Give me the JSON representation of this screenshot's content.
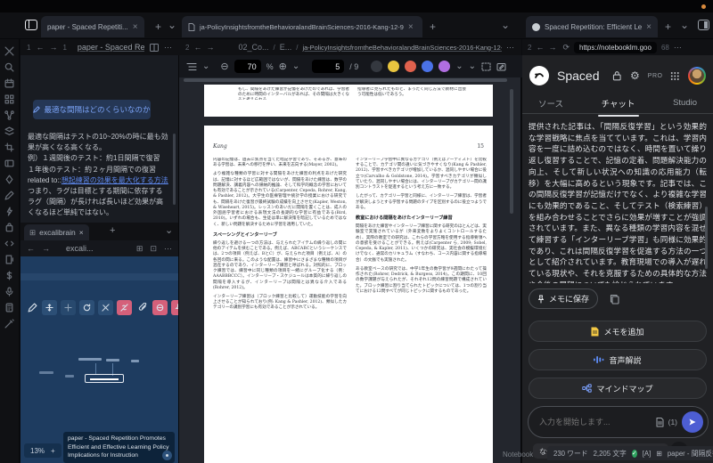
{
  "glyphs": {
    "close": "×",
    "plus": "+",
    "chevron_down": "⌄",
    "more": "⋯",
    "back": "←",
    "forward": "→",
    "reload": "⟳",
    "gear": "⚙",
    "zoom_out": "⊖",
    "zoom_in": "⊕",
    "percent": "%",
    "slash": "/ 9",
    "grid_box": "⊞",
    "box_dot": "⊡",
    "check": "✓",
    "chevron_right": "›"
  },
  "tabbar": {
    "pane1_tab": "paper - Spaced Repetiti...",
    "pane2_tab": "ja-PolicyInsightsfromtheBehavioralandBrainSciences-2016-Kang-12-9",
    "pane3_tab": "Spaced Repetition: Efficient Learn..."
  },
  "nav1": {
    "back_count": "1",
    "forward_count": "1",
    "title": "paper - Spaced Re..."
  },
  "nav2": {
    "back_count": "2",
    "crumb1": "02_Co...",
    "sep": "/",
    "crumb2": "E...",
    "crumb3": "ja-PolicyInsightsfromtheBehavioralandBrainSciences-2016-Kang-12-9"
  },
  "nav3": {
    "back_count": "2",
    "url": "https://notebooklm.goo",
    "count": "68"
  },
  "notes": {
    "callout": "最適な間隔はどのくらいなのか",
    "p1": "最適な間隔はテストの10~20%の時に最も効果が高くなる高くなる。",
    "p2": "例）１週間後のテスト：約1日間隔で復習",
    "p3": "１年後のテスト：約２ヶ月間隔での復習",
    "related_label": "related to::",
    "related_link": "想起練習の効果を最大化する方法",
    "p4": "つまり、ラグは目標とする期間に依存する",
    "p5": "ラグ（間隔）が長ければ長いほど効果が高くなるほど単純ではない。"
  },
  "excalibrain": {
    "tab": "excalibrain",
    "pane_title": "excali...",
    "zoom": "13%",
    "node_title": "paper - Spaced Repetition Promotes Efficient and Effective Learning Policy Implications for Instruction"
  },
  "pdf": {
    "zoom_value": "70",
    "page_value": "5",
    "page_total": "/ 9",
    "colors": {
      "yellow": "#e9c53f",
      "red": "#e0614d",
      "blue": "#4a72e8",
      "purple": "#b06ee0"
    },
    "page4_left": "もし、間隔をあけた練習が記憶をあげたのであれば、学習者のために時間のインターバルがあれば、その間隔は大きくなると考えられる。",
    "page4_right": "指導者に見られたものと、まったく同じ方法で教材に出会う可能性は低いであろう。",
    "page5": {
      "header_left": "Kang",
      "header_right": "15",
      "left_p1": "内容の記憶は、過去に焦点を当てた暗記学習であり、そあるか、意味のある学習は、未来への移行を伴い、未来を志向する(Mayer, 2002)。",
      "left_p2": "より複雑な種類の学習に対する間隔をあけた練習の利点をあげた研究は、記憶に対するほど広範囲ではないが、間隔をあけた練習は、数学の問題解決、講義内容への帰納的推論、そして科学的概念の学習においても有効であることが示されている(Carpenter, Cepeda, Rohrer, Kang, & Pashler, 2012)。大学生の医療管理や統計学の授業における研究でも、間隔をあけた復習が最終試験の成績を向上させた(Kapler, Weston, & Wiseheart, 2015)。レッスンのあいだに間隔を置くことは、成人の外国語学習者における表現文法の長期的な学習に有益である(Bird, 2010)。いずれの場合も、生徒は単に解決策を暗記しているためではなく、新しい問題を解決するために学習を適用していた。",
      "left_heading": "スペーシングとインターリーブ",
      "left_p3": "繰り返しを避ける一つの方法は、与えられたアイテムの繰り返しの間に他のアイテムを挟むことである。例えば、ABCABCというシーケンスでは、2つの項目（例えば、BとC）が、与えられた項目（例えば、A）の各回の間に来る。このような配置は、練習中にさまざまな種類の項目が混在するのであり、インターリーブ練習と呼ばれる。対照的に、ブロック練習では、練習中に同じ種類の項目を一緒にグループ化する（例：AAABBBCCC）。インターリーブ・スケジュールは本質的に繰り返しの間隔を導入するが、インターリーブは間隔とは異なる介入である(Rohrer, 2012)。",
      "left_p4": "インターリーブ練習は（ブロック練習と比較して）運動技能の学習を向上させることが知られており(例: Kang & Pashler, 2012)、類似したカテゴリーの識別学習にも有効であることが示されている。",
      "right_p1": "インターリーブ学習中に異なるカテゴリ（例えばアーティスト）を比較することで、カテゴリ間の違いに気づきやすくなり(Kang & Pashler, 2012)、学習すべきカテゴリが増加しているか、混同しやすい場合に役立つ(Carvalho & Goldstone, 2014)。学習すべきカテゴリが類似していたり、混同しやすい場合には、インターリーブがカテゴリー間の識別コントラストを促進するという考え方に一致する。",
      "right_p2": "したがって、カテゴリー学習と同様に、インターリーブ練習は、学習者が解決しようとする学習する問題のタイプを区別するのに役立つようである。",
      "right_heading": "教室における間隔をあけたインターリーブ練習",
      "right_p3": "間隔をあけた練習やインターリーブ練習に関する研究のほとんどは、実験室で実施されているが（外来変数をよりよくコントロールするため）、実際の教室での研究は、これらの学習方略を使用する指導要領への意欲を受けることができる。例えば(Carpenter ら, 2009; Sobel, Cepeda, & Kapler, 2011)、いくつかの研究は、実社会の模擬環境だけでなく、通常のカリキュラム（すなわち、コース内容に関する指導場合）の文脈でも実施された。",
      "right_p4": "ある教室ベースの研究では、中学1年生の数学習が9週間にわたって操作された(Rohrer, Dedrick, & Burgess, 2014)。この期間に、10回の数学課題が与えられたが、それぞれ12問の練習問題で構成されていた。ブロック練習に割り当てられたトピックについては、1つの割り当てにおける12問すべてが同じトピックに関するものであった。"
    }
  },
  "notebook": {
    "title": "Spaced",
    "pro": "PRO",
    "tabs": {
      "sources": "ソース",
      "chat": "チャット",
      "studio": "Studio"
    },
    "chat_text": "提供された記事は、「間隔反復学習」という効果的な学習戦略に焦点を当てています。これは、学習内容を一度に詰め込むのではなく、時間を置いて繰り返し復習することで、記憶の定着、問題解決能力の向上、そして新しい状況への知識の応用能力（転移）を大幅に高めるという現象です。記事では、この間隔反復学習が記憶だけでなく、より複雑な学習にも効果的であること、そしてテスト（検索練習）を組み合わせることでさらに効果が増すことが強調されています。また、異なる種類の学習内容を混ぜて練習する「インターリーブ学習」も同様に効果的であり、これは間隔反復学習を促進する方法の一つとして紹介されています。教育現場での導入が遅れている現状や、それを克服するための具体的な方法や今後の展望についても論じられています。",
    "save_note": "メモに保存",
    "add_note": "メモを追加",
    "audio": "音声解説",
    "mindmap": "マインドマップ",
    "input_placeholder": "入力を開始します...",
    "source_count": "(1)",
    "suggestion": "なぜ分散学習は効果的で効率的な学習に繋がる",
    "footer": "Notebook"
  },
  "statusbar": {
    "words": "230 ワード",
    "chars": "2,205 文字",
    "lang": "[A]",
    "doc": "paper - 間隔反復"
  }
}
